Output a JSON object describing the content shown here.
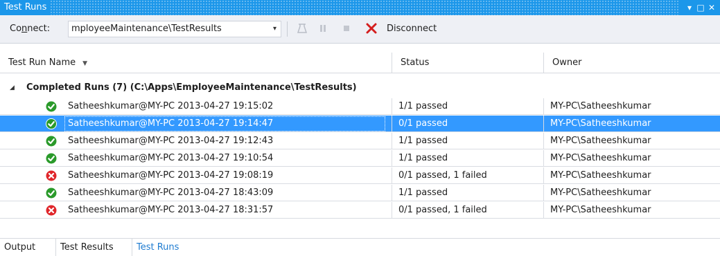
{
  "window": {
    "title": "Test Runs",
    "controls": [
      "▾",
      "□",
      "✕"
    ]
  },
  "toolbar": {
    "connect_label_prefix": "Co",
    "connect_label_underlined": "n",
    "connect_label_suffix": "nect:",
    "connect_value": "mployeeMaintenance\\TestResults",
    "disconnect_label": "Disconnect"
  },
  "columns": {
    "name": "Test Run Name",
    "status": "Status",
    "owner": "Owner"
  },
  "group": {
    "label": "Completed Runs (7) (C:\\Apps\\EmployeeMaintenance\\TestResults)"
  },
  "runs": [
    {
      "name": "Satheeshkumar@MY-PC 2013-04-27 19:15:02",
      "status": "1/1 passed",
      "owner": "MY-PC\\Satheeshkumar",
      "result": "passed"
    },
    {
      "name": "Satheeshkumar@MY-PC 2013-04-27 19:14:47",
      "status": "0/1 passed",
      "owner": "MY-PC\\Satheeshkumar",
      "result": "passed",
      "selected": true
    },
    {
      "name": "Satheeshkumar@MY-PC 2013-04-27 19:12:43",
      "status": "1/1 passed",
      "owner": "MY-PC\\Satheeshkumar",
      "result": "passed"
    },
    {
      "name": "Satheeshkumar@MY-PC 2013-04-27 19:10:54",
      "status": "1/1 passed",
      "owner": "MY-PC\\Satheeshkumar",
      "result": "passed"
    },
    {
      "name": "Satheeshkumar@MY-PC 2013-04-27 19:08:19",
      "status": "0/1 passed, 1 failed",
      "owner": "MY-PC\\Satheeshkumar",
      "result": "failed"
    },
    {
      "name": "Satheeshkumar@MY-PC 2013-04-27 18:43:09",
      "status": "1/1 passed",
      "owner": "MY-PC\\Satheeshkumar",
      "result": "passed"
    },
    {
      "name": "Satheeshkumar@MY-PC 2013-04-27 18:31:57",
      "status": "0/1 passed, 1 failed",
      "owner": "MY-PC\\Satheeshkumar",
      "result": "failed"
    }
  ],
  "tabs": [
    {
      "label": "Output"
    },
    {
      "label": "Test Results"
    },
    {
      "label": "Test Runs",
      "active": true
    }
  ],
  "colors": {
    "accent": "#1c97ea",
    "selection": "#3399ff",
    "passed": "#2a9a2a",
    "failed": "#e0262b"
  }
}
